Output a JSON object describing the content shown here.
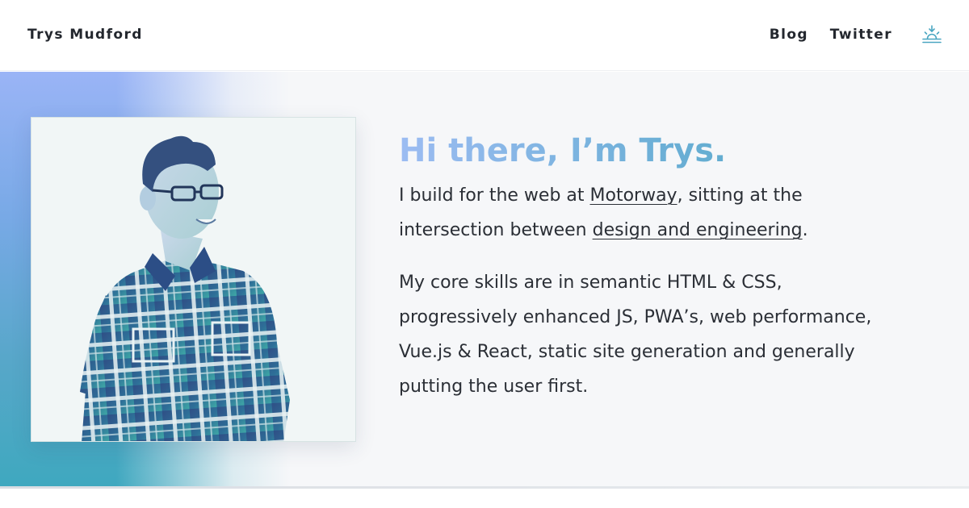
{
  "header": {
    "brand": "Trys Mudford",
    "nav": {
      "blog": "Blog",
      "twitter": "Twitter"
    },
    "theme_toggle_icon": "sunrise-icon",
    "theme_toggle_color": "#4aa6c1"
  },
  "hero": {
    "greeting": "Hi there, I’m Trys.",
    "intro": {
      "before_link1": "I build for the web at ",
      "link1": "Motorway",
      "between": ", sitting at the intersection between ",
      "link2": "design and engineering",
      "after": "."
    },
    "skills": "My core skills are in semantic HTML & CSS, progressively enhanced JS, PWA’s, web performance, Vue.js & React, static site generation and generally putting the user first.",
    "portrait_icon": "portrait-photo",
    "colors": {
      "gradient_start": "#9cbcf2",
      "gradient_end": "#4aa6c1",
      "background": "#f6f7f9"
    }
  }
}
